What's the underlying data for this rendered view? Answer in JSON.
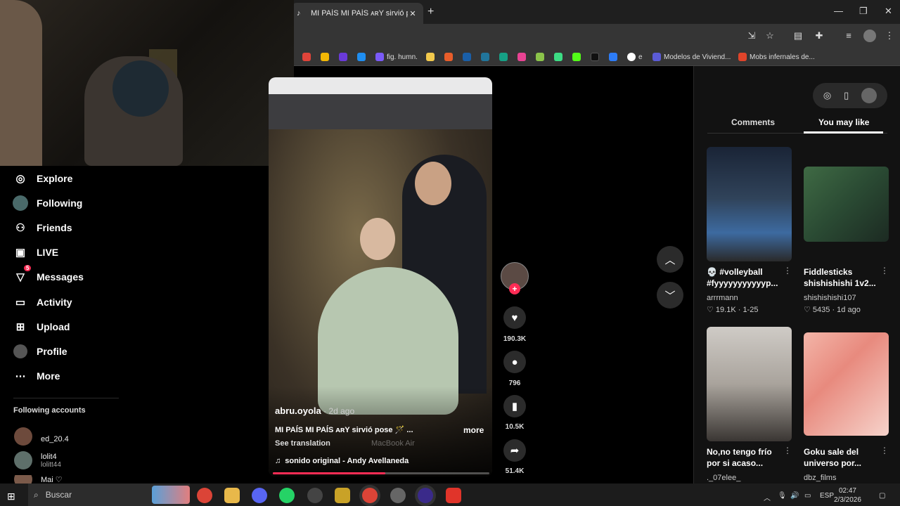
{
  "browser": {
    "tab_title": "MI PAÍS MI PAÍS ᴀʀY sirvió pos",
    "tab_close": "✕",
    "new_tab": "+",
    "window": {
      "minimize": "—",
      "restore": "❐",
      "close": "✕"
    },
    "bookmarks": [
      {
        "label": "fig. humn.",
        "color": "#7a5af8"
      },
      {
        "label": "e",
        "color": "#ffffff"
      },
      {
        "label": "Modelos de Viviend...",
        "color": "#5b5bd6"
      },
      {
        "label": "Mobs infernales de...",
        "color": "#e0442a"
      }
    ]
  },
  "sidebar": {
    "items": [
      {
        "label": "Explore",
        "icon": "compass-icon"
      },
      {
        "label": "Following",
        "icon": "avatar-icon"
      },
      {
        "label": "Friends",
        "icon": "friends-icon"
      },
      {
        "label": "LIVE",
        "icon": "live-icon"
      },
      {
        "label": "Messages",
        "icon": "messages-icon",
        "badge": "5"
      },
      {
        "label": "Activity",
        "icon": "activity-icon"
      },
      {
        "label": "Upload",
        "icon": "upload-icon"
      },
      {
        "label": "Profile",
        "icon": "profile-icon"
      },
      {
        "label": "More",
        "icon": "more-icon"
      }
    ],
    "following_title": "Following accounts",
    "accounts": [
      {
        "name": "ed_20.4",
        "handle": ""
      },
      {
        "name": "lolit4",
        "handle": "lolitt44"
      },
      {
        "name": "Mai ♡",
        "handle": ""
      }
    ]
  },
  "video": {
    "author": "abru.oyola",
    "age": " · 2d ago",
    "caption": "MI PAÍS MI PAÍS ᴀʀY sirvió pose 🪄 ...",
    "more": "more",
    "see_translation": "See translation",
    "watermark": "MacBook Air",
    "sound": "sonido original - Andy Avellaneda",
    "progress": 0.52,
    "likes": "190.3K",
    "comments": "796",
    "saves": "10.5K",
    "shares": "51.4K"
  },
  "right_panel": {
    "tabs": [
      "Comments",
      "You may like"
    ],
    "active_tab": "You may like",
    "cards": [
      {
        "title": "💀 #volleyball #fyyyyyyyyyyyp...",
        "author": "arrrmann",
        "meta": "♡ 19.1K · 1-25"
      },
      {
        "title": "Fiddlesticks shishishishi 1v2...",
        "author": "shishishishi107",
        "meta": "♡ 5435 · 1d ago"
      },
      {
        "title": "No,no tengo frío por si acaso...",
        "author": "._07elee_",
        "meta": ""
      },
      {
        "title": "Goku sale del universo por...",
        "author": "dbz_films",
        "meta": ""
      }
    ]
  },
  "taskbar": {
    "search_label": "Buscar",
    "language": "ESP",
    "time": "02:47",
    "date": "2/3/2026"
  },
  "colors": {
    "accent": "#fe2c55",
    "background": "#000000",
    "panel": "#121212"
  }
}
